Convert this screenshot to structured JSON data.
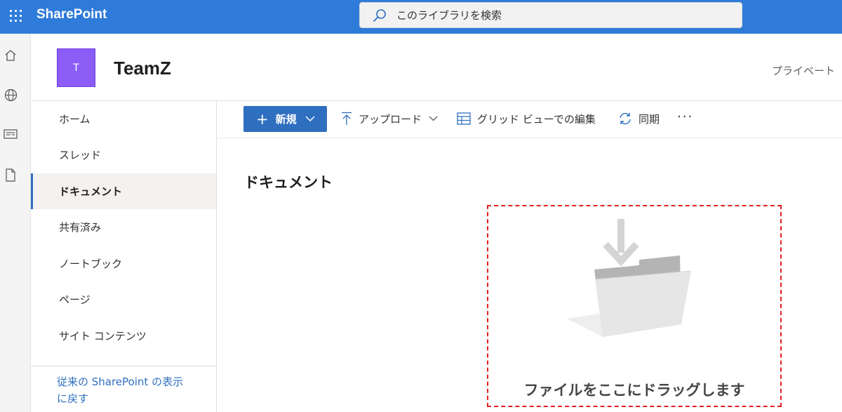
{
  "suite": {
    "app_name": "SharePoint",
    "search_placeholder": "このライブラリを検索"
  },
  "rail": {
    "icons": [
      "home-icon",
      "globe-icon",
      "news-icon",
      "document-icon"
    ]
  },
  "site": {
    "logo_letter": "T",
    "title": "TeamZ",
    "privacy": "プライベート"
  },
  "nav": {
    "items": [
      {
        "label": "ホーム",
        "selected": false
      },
      {
        "label": "スレッド",
        "selected": false
      },
      {
        "label": "ドキュメント",
        "selected": true
      },
      {
        "label": "共有済み",
        "selected": false
      },
      {
        "label": "ノートブック",
        "selected": false
      },
      {
        "label": "ページ",
        "selected": false
      },
      {
        "label": "サイト コンテンツ",
        "selected": false
      }
    ],
    "classic_link_line1": "従来の SharePoint の表示",
    "classic_link_line2": "に戻す"
  },
  "commands": {
    "new_label": "新規",
    "upload_label": "アップロード",
    "grid_edit_label": "グリッド ビューでの編集",
    "sync_label": "同期",
    "more_label": "···"
  },
  "library": {
    "title": "ドキュメント",
    "drop_text": "ファイルをここにドラッグします"
  },
  "colors": {
    "suite_bar": "#2f7bd9",
    "accent": "#2f6fbf",
    "site_logo": "#8b5cf6",
    "dropzone_border": "#e02020"
  }
}
